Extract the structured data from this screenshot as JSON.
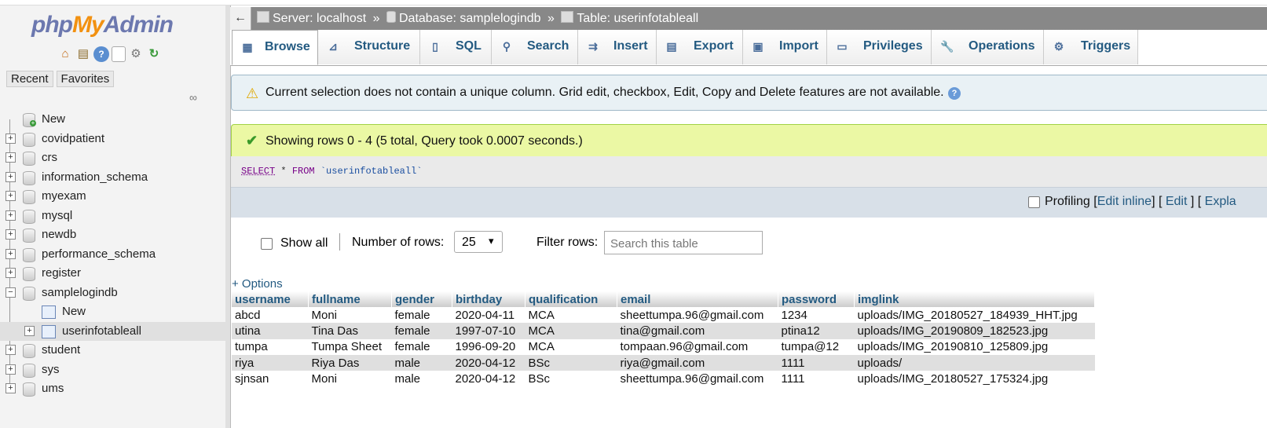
{
  "sidebar": {
    "logo": {
      "php": "php",
      "my": "My",
      "admin": "Admin"
    },
    "icons": [
      "home-icon",
      "exit-icon",
      "help-icon",
      "docs-icon",
      "settings-icon",
      "reload-icon"
    ],
    "recent_label": "Recent",
    "favorites_label": "Favorites",
    "tree": {
      "new_label": "New",
      "databases": [
        "covidpatient",
        "crs",
        "information_schema",
        "myexam",
        "mysql",
        "newdb",
        "performance_schema",
        "register",
        "samplelogindb",
        "student",
        "sys",
        "ums"
      ],
      "samplelogindb_children": {
        "new_label": "New",
        "table": "userinfotableall"
      }
    }
  },
  "breadcrumb": {
    "back": "←",
    "server": "Server: localhost",
    "database": "Database: samplelogindb",
    "table": "Table: userinfotableall",
    "sep": "»"
  },
  "tabs": [
    {
      "label": "Browse",
      "icon": "browse-icon"
    },
    {
      "label": "Structure",
      "icon": "structure-icon"
    },
    {
      "label": "SQL",
      "icon": "sql-icon"
    },
    {
      "label": "Search",
      "icon": "search-icon"
    },
    {
      "label": "Insert",
      "icon": "insert-icon"
    },
    {
      "label": "Export",
      "icon": "export-icon"
    },
    {
      "label": "Import",
      "icon": "import-icon"
    },
    {
      "label": "Privileges",
      "icon": "privileges-icon"
    },
    {
      "label": "Operations",
      "icon": "operations-icon"
    },
    {
      "label": "Triggers",
      "icon": "triggers-icon"
    }
  ],
  "notice": "Current selection does not contain a unique column. Grid edit, checkbox, Edit, Copy and Delete features are not available.",
  "success": "Showing rows 0 - 4 (5 total, Query took 0.0007 seconds.)",
  "sql": {
    "select": "SELECT",
    "star": "*",
    "from": "FROM",
    "table": "`userinfotableall`"
  },
  "profiling": {
    "label": "Profiling",
    "edit_inline": "Edit inline",
    "edit": "Edit",
    "explain": "Expla"
  },
  "controls": {
    "show_all": "Show all",
    "number_of_rows_label": "Number of rows:",
    "rows_value": "25",
    "filter_label": "Filter rows:",
    "filter_placeholder": "Search this table"
  },
  "options_label": "+ Options",
  "table": {
    "columns": [
      "username",
      "fullname",
      "gender",
      "birthday",
      "qualification",
      "email",
      "password",
      "imglink"
    ],
    "rows": [
      [
        "abcd",
        "Moni",
        "female",
        "2020-04-11",
        "MCA",
        "sheettumpa.96@gmail.com",
        "1234",
        "uploads/IMG_20180527_184939_HHT.jpg"
      ],
      [
        "utina",
        "Tina Das",
        "female",
        "1997-07-10",
        "MCA",
        "tina@gmail.com",
        "ptina12",
        "uploads/IMG_20190809_182523.jpg"
      ],
      [
        "tumpa",
        "Tumpa Sheet",
        "female",
        "1996-09-20",
        "MCA",
        "tompaan.96@gmail.com",
        "tumpa@12",
        "uploads/IMG_20190810_125809.jpg"
      ],
      [
        "riya",
        "Riya Das",
        "male",
        "2020-04-12",
        "BSc",
        "riya@gmail.com",
        "1111",
        "uploads/"
      ],
      [
        "sjnsan",
        "Moni",
        "male",
        "2020-04-12",
        "BSc",
        "sheettumpa.96@gmail.com",
        "1111",
        "uploads/IMG_20180527_175324.jpg"
      ]
    ]
  }
}
